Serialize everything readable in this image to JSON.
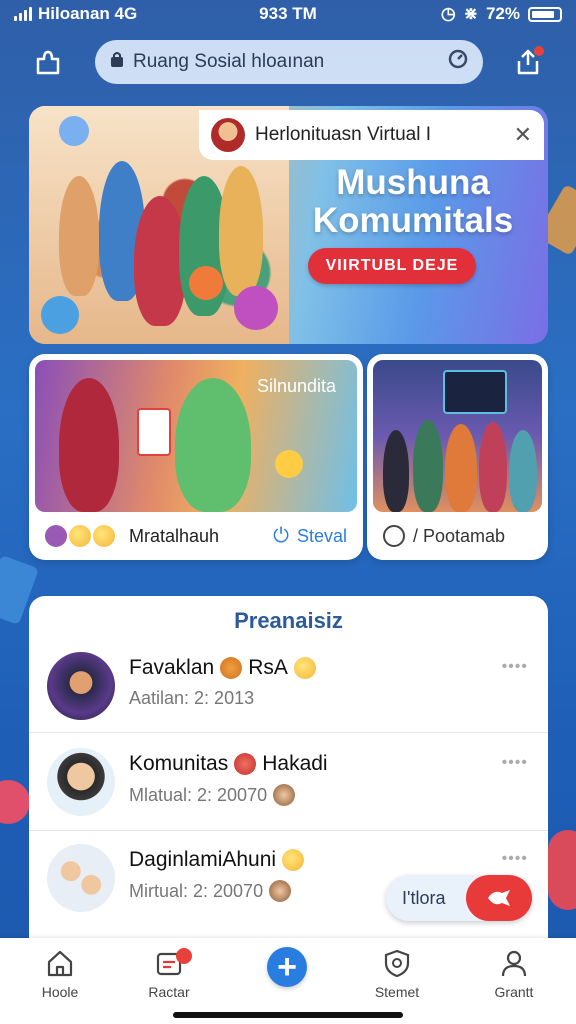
{
  "status_bar": {
    "carrier": "Hiloanan 4G",
    "time": "933 TM",
    "battery": "72%"
  },
  "search": {
    "placeholder": "Ruang Sosial hloaınan"
  },
  "hero": {
    "pill_text": "Herlonituasn Virtual I",
    "title_line1": "Mushuna",
    "title_line2": "Komumitals",
    "cta_label": "VIIRTUBL DEJE"
  },
  "card_left": {
    "overlay_text": "Silnundita",
    "footer_label": "Mratalhauh",
    "footer_action": "Steval"
  },
  "card_right": {
    "footer_label": "/ Pootamab"
  },
  "feed": {
    "header": "Preanaisiz",
    "items": [
      {
        "name": "Favaklan",
        "tag": "RsA",
        "subtitle": "Aatilan: 2: 2013",
        "more": "••••"
      },
      {
        "name": "Komunitas",
        "tag": "Hakadi",
        "subtitle": "Mlatual: 2: 20070",
        "more": "••••"
      },
      {
        "name": "DaginlamiAhuni",
        "tag": "",
        "subtitle": "Mirtual: 2: 20070",
        "more": "••••"
      }
    ]
  },
  "float_button": {
    "label": "I'tlora"
  },
  "nav": {
    "items": [
      {
        "label": "Hoole",
        "icon": "home-icon"
      },
      {
        "label": "Ractar",
        "icon": "messages-icon"
      },
      {
        "label": "",
        "icon": "plus-icon"
      },
      {
        "label": "Stemet",
        "icon": "shield-icon"
      },
      {
        "label": "Grantt",
        "icon": "user-icon"
      }
    ]
  },
  "colors": {
    "accent": "#2a7de0",
    "cta": "#e2303b",
    "header_text": "#2c5a9a"
  }
}
